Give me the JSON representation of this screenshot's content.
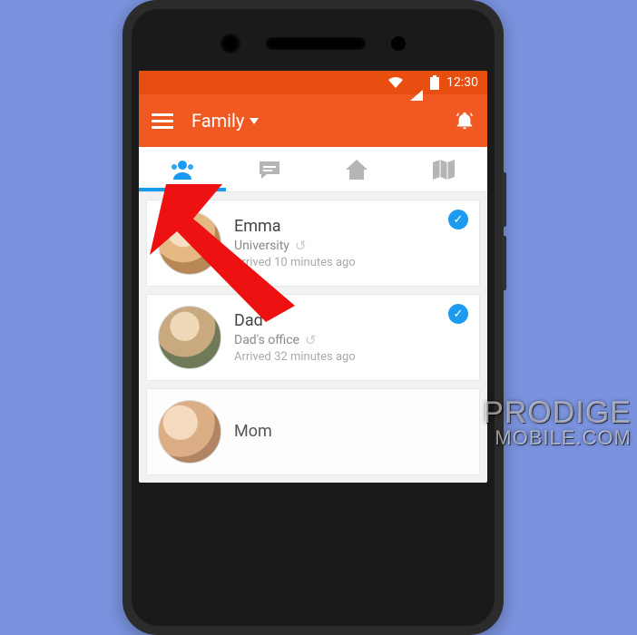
{
  "statusbar": {
    "time": "12:30"
  },
  "appbar": {
    "title": "Family"
  },
  "tabs": [
    {
      "id": "people",
      "active": true
    },
    {
      "id": "messages",
      "active": false
    },
    {
      "id": "home",
      "active": false
    },
    {
      "id": "map",
      "active": false
    }
  ],
  "members": [
    {
      "name": "Emma",
      "location": "University",
      "arrived": "Arrived 10 minutes ago",
      "checked": true
    },
    {
      "name": "Dad",
      "location": "Dad's office",
      "arrived": "Arrived 32 minutes ago",
      "checked": true
    },
    {
      "name": "Mom",
      "location": "",
      "arrived": "",
      "checked": false
    }
  ],
  "watermark": {
    "line1": "PRODIGE",
    "line2": "MOBILE.COM"
  }
}
